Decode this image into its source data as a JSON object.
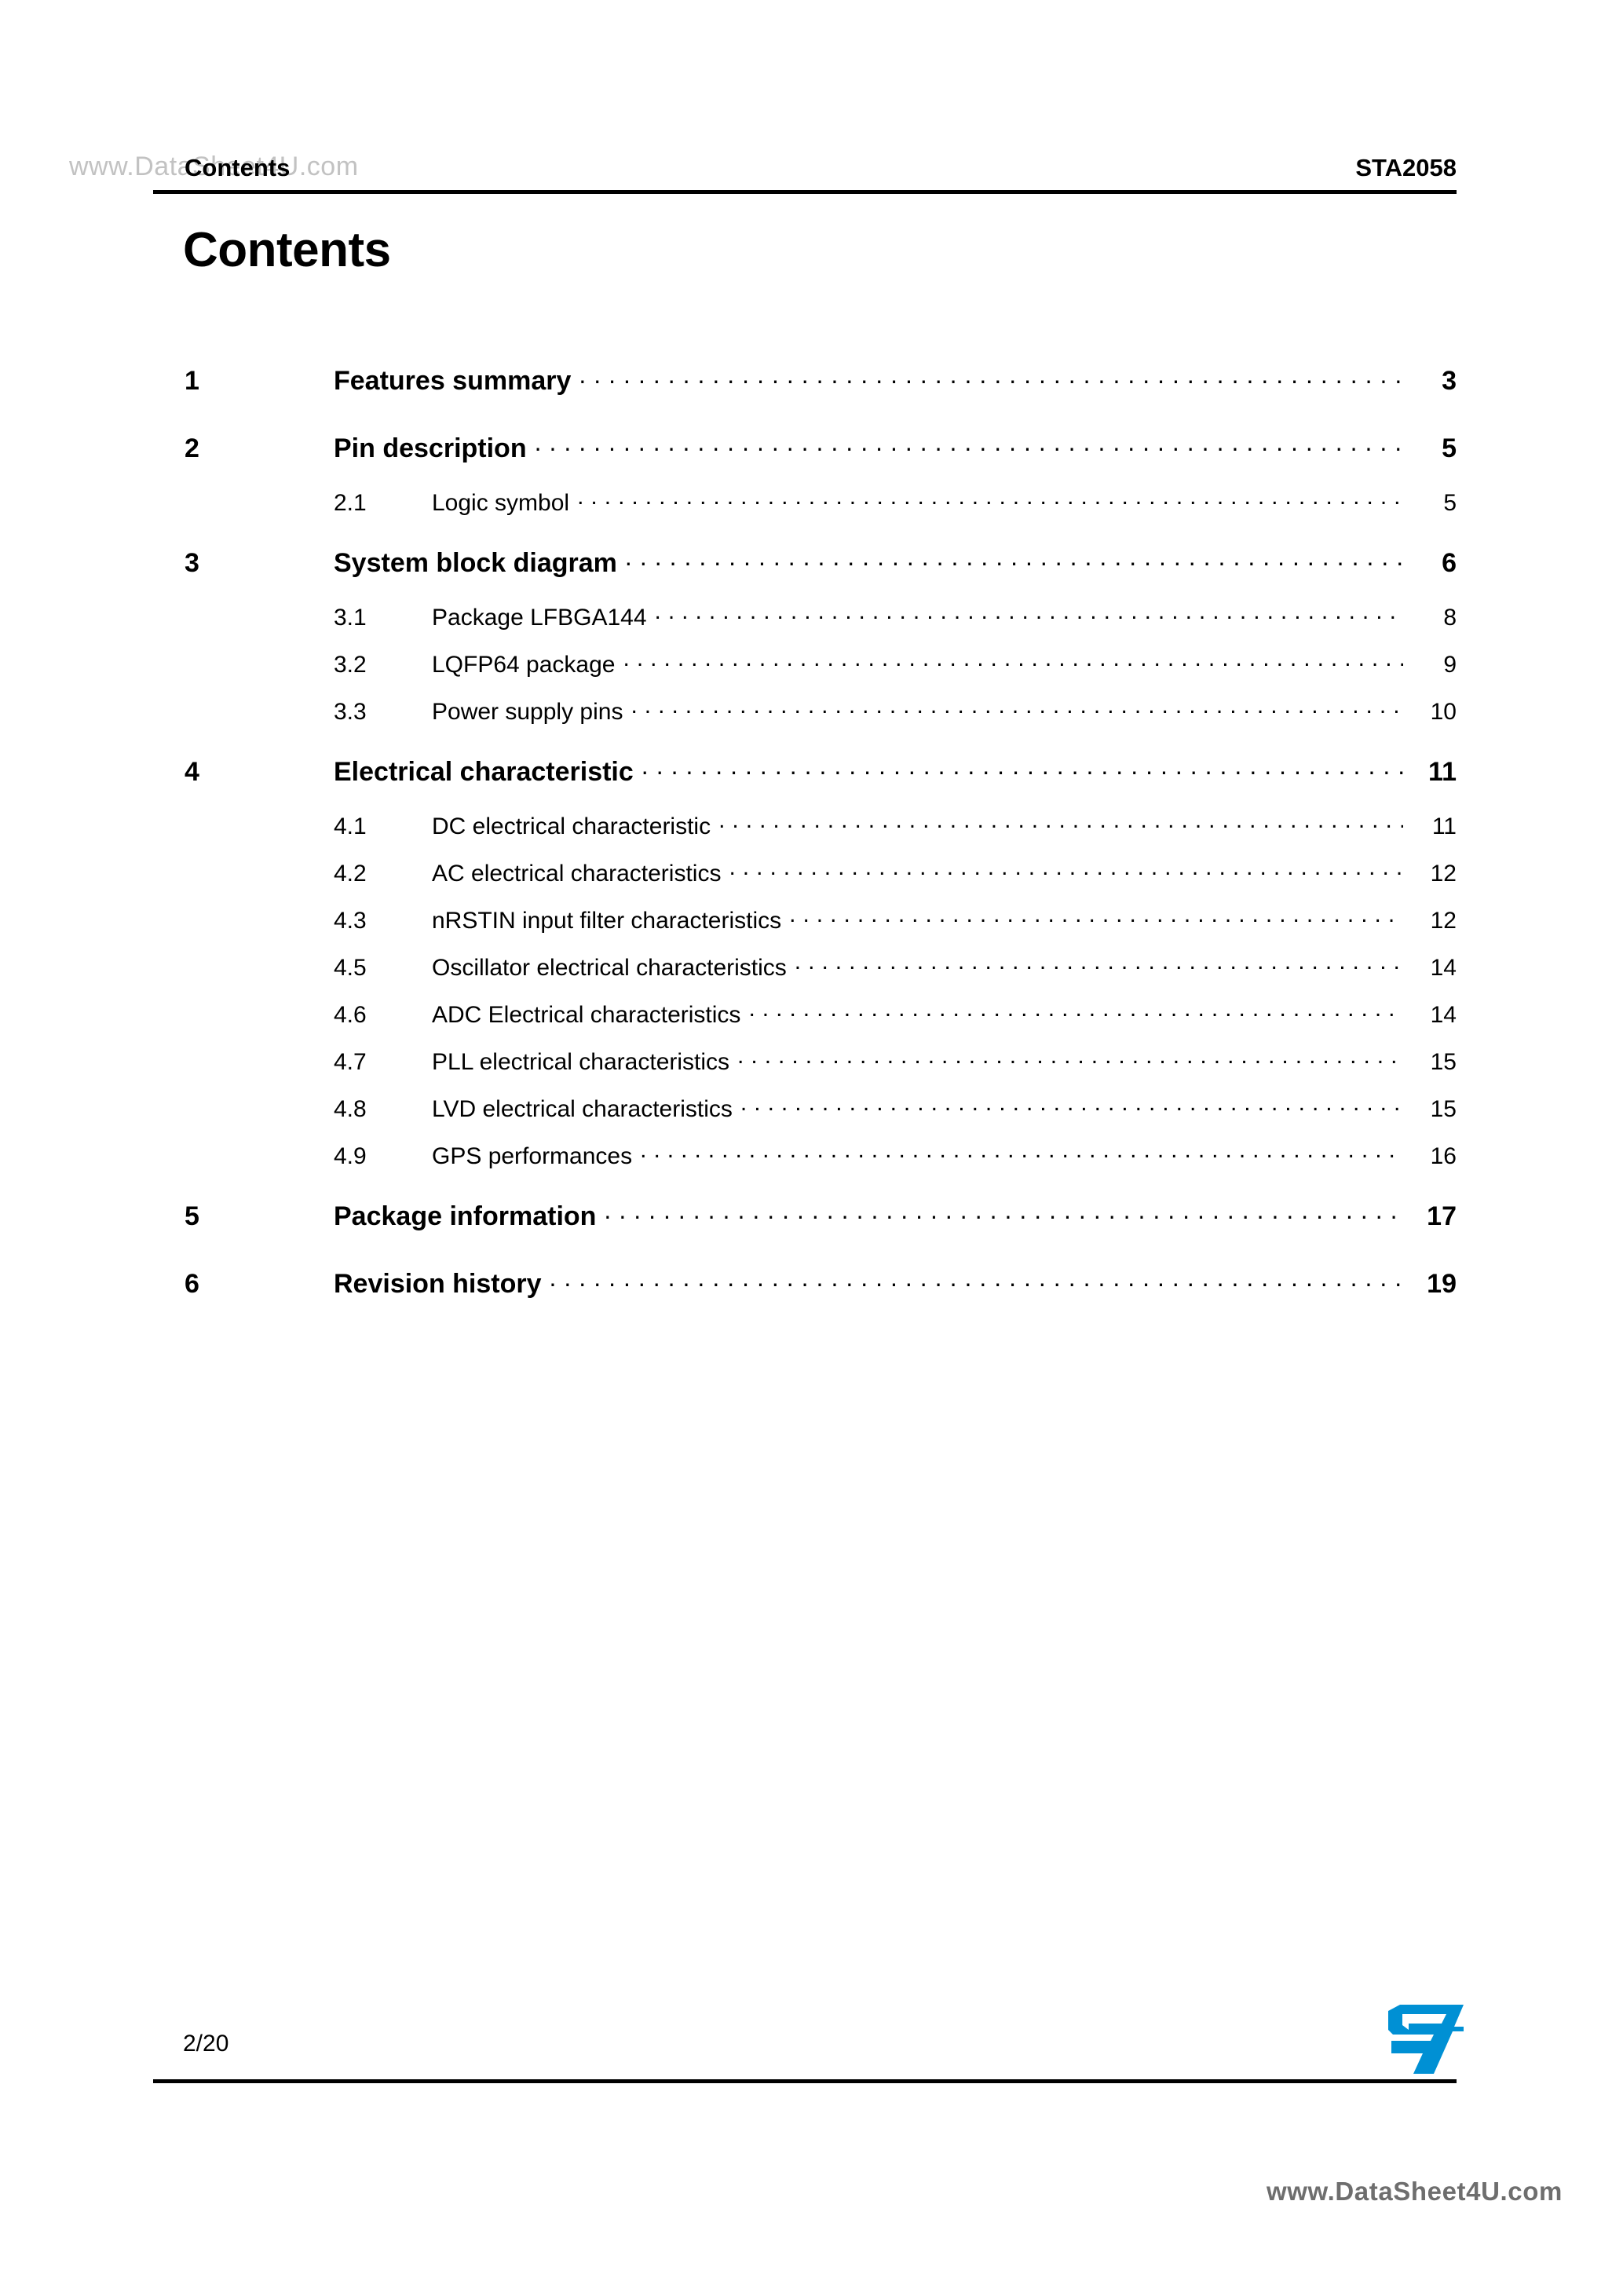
{
  "document": {
    "header_left": "Contents",
    "header_right": "STA2058",
    "page_title": "Contents",
    "footer_page": "2/20",
    "brand_color": "#0090D4",
    "logo_name": "st-logo"
  },
  "watermark": {
    "top": "www.DataSheet4U.com",
    "bottom": "www.DataSheet4U.com"
  },
  "toc": {
    "entries": [
      {
        "level": 1,
        "num": "1",
        "label": "Features summary",
        "page": "3"
      },
      {
        "level": 1,
        "num": "2",
        "label": "Pin description",
        "page": "5"
      },
      {
        "level": 2,
        "num": "2.1",
        "label": "Logic symbol",
        "page": "5"
      },
      {
        "level": 1,
        "num": "3",
        "label": "System block diagram",
        "page": "6"
      },
      {
        "level": 2,
        "num": "3.1",
        "label": "Package LFBGA144",
        "page": "8"
      },
      {
        "level": 2,
        "num": "3.2",
        "label": "LQFP64 package",
        "page": "9"
      },
      {
        "level": 2,
        "num": "3.3",
        "label": "Power supply pins",
        "page": "10"
      },
      {
        "level": 1,
        "num": "4",
        "label": "Electrical characteristic",
        "page": "11"
      },
      {
        "level": 2,
        "num": "4.1",
        "label": "DC electrical characteristic",
        "page": "11"
      },
      {
        "level": 2,
        "num": "4.2",
        "label": "AC electrical characteristics",
        "page": "12"
      },
      {
        "level": 2,
        "num": "4.3",
        "label": "nRSTIN input filter characteristics",
        "page": "12"
      },
      {
        "level": 2,
        "num": "4.5",
        "label": "Oscillator electrical characteristics",
        "page": "14"
      },
      {
        "level": 2,
        "num": "4.6",
        "label": "ADC Electrical characteristics",
        "page": "14"
      },
      {
        "level": 2,
        "num": "4.7",
        "label": "PLL electrical characteristics",
        "page": "15"
      },
      {
        "level": 2,
        "num": "4.8",
        "label": "LVD electrical characteristics",
        "page": "15"
      },
      {
        "level": 2,
        "num": "4.9",
        "label": "GPS performances",
        "page": "16"
      },
      {
        "level": 1,
        "num": "5",
        "label": "Package information",
        "page": "17"
      },
      {
        "level": 1,
        "num": "6",
        "label": "Revision history",
        "page": "19"
      }
    ]
  }
}
